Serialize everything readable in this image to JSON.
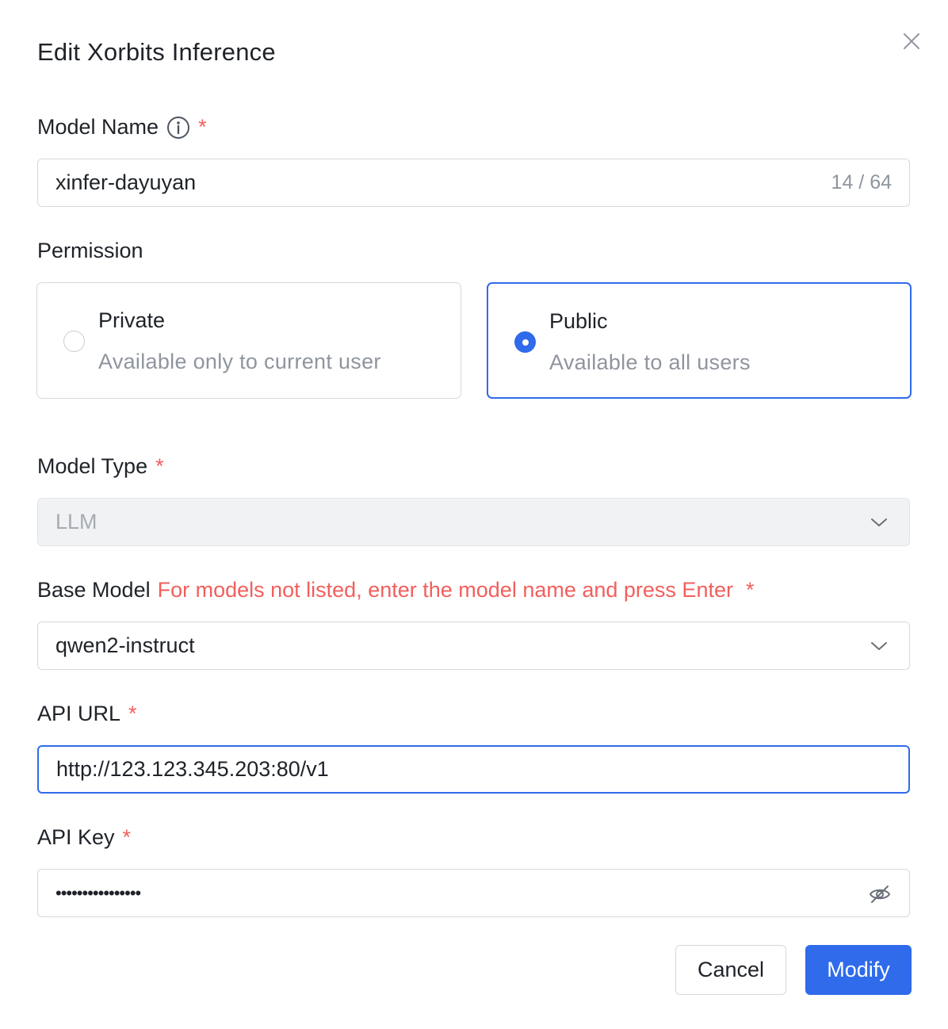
{
  "dialog": {
    "title": "Edit Xorbits Inference"
  },
  "model_name": {
    "label": "Model Name",
    "required_mark": "*",
    "value": "xinfer-dayuyan",
    "counter": "14 / 64"
  },
  "permission": {
    "label": "Permission",
    "options": [
      {
        "title": "Private",
        "description": "Available only to current user",
        "selected": false
      },
      {
        "title": "Public",
        "description": "Available to all users",
        "selected": true
      }
    ]
  },
  "model_type": {
    "label": "Model Type",
    "required_mark": "*",
    "value": "LLM"
  },
  "base_model": {
    "label": "Base Model",
    "hint": "For models not listed, enter the model name and press Enter",
    "required_mark": "*",
    "value": "qwen2-instruct"
  },
  "api_url": {
    "label": "API URL",
    "required_mark": "*",
    "value": "http://123.123.345.203:80/v1"
  },
  "api_key": {
    "label": "API Key",
    "required_mark": "*",
    "masked_value": "••••••••••••••••"
  },
  "buttons": {
    "cancel": "Cancel",
    "modify": "Modify"
  },
  "colors": {
    "primary": "#2f6bea",
    "required": "#f25f5c",
    "placeholder": "#8f959e"
  }
}
